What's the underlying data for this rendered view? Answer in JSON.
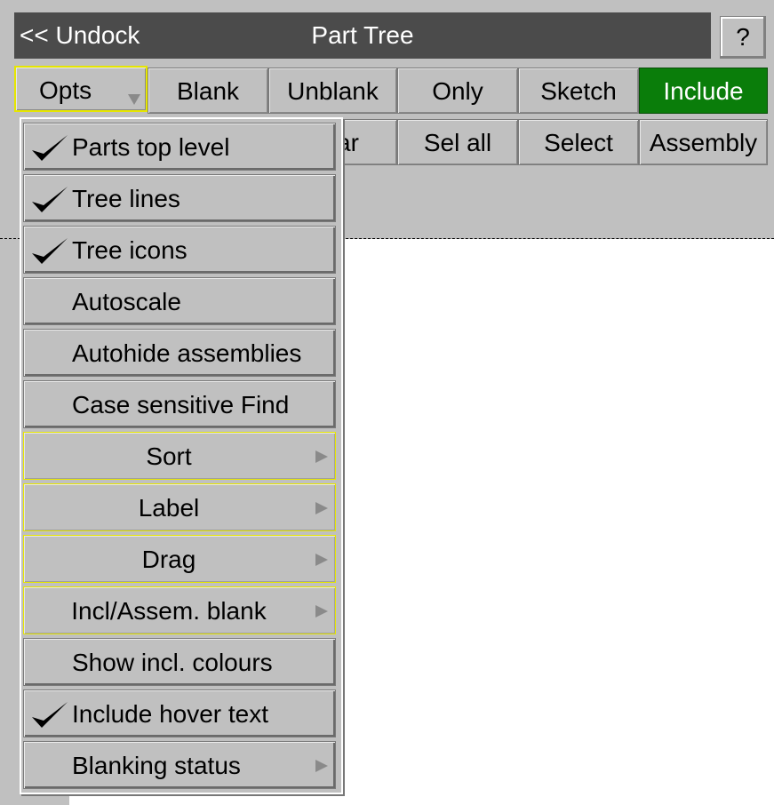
{
  "window": {
    "undock_label": "<< Undock",
    "title": "Part Tree",
    "help_label": "?"
  },
  "toolbar_row1": {
    "opts": "Opts",
    "blank": "Blank",
    "unblank": "Unblank",
    "only": "Only",
    "sketch": "Sketch",
    "include": "Include"
  },
  "toolbar_row2": {
    "clear_partial": "ar",
    "sel_all": "Sel all",
    "select": "Select",
    "assembly": "Assembly"
  },
  "opts_menu": {
    "items": [
      {
        "label": "Parts top level",
        "checked": true
      },
      {
        "label": "Tree lines",
        "checked": true
      },
      {
        "label": "Tree icons",
        "checked": true
      },
      {
        "label": "Autoscale",
        "checked": false
      },
      {
        "label": "Autohide assemblies",
        "checked": false
      },
      {
        "label": "Case sensitive Find",
        "checked": false
      },
      {
        "label": "Sort",
        "submenu": true
      },
      {
        "label": "Label",
        "submenu": true
      },
      {
        "label": "Drag",
        "submenu": true
      },
      {
        "label": "Incl/Assem. blank",
        "submenu": true
      },
      {
        "label": "Show incl. colours",
        "checked": false
      },
      {
        "label": "Include hover text",
        "checked": true
      },
      {
        "label": "Blanking status",
        "submenu": true
      }
    ]
  },
  "colors": {
    "panel": "#c0c0c0",
    "titlebar": "#4b4b4b",
    "include_active": "#0a7d0a",
    "focus_outline": "#e6e600"
  }
}
